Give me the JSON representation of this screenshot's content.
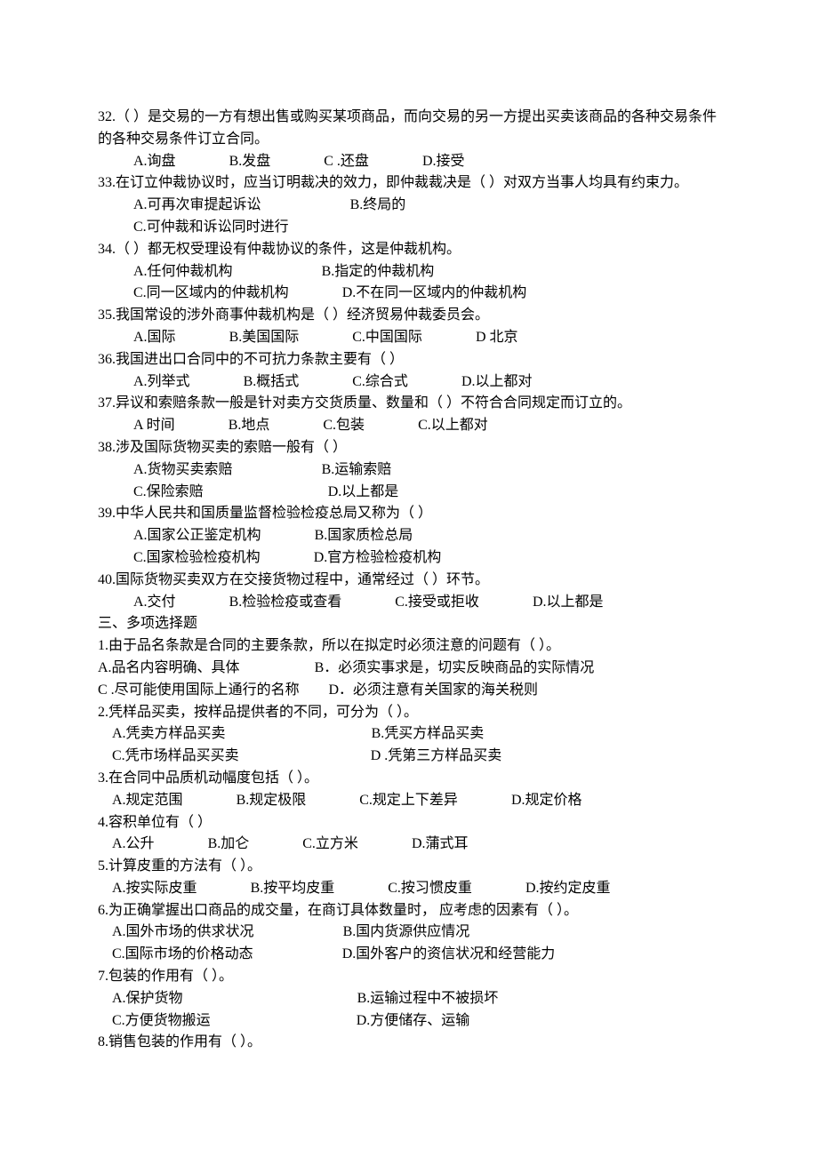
{
  "q32": {
    "text": "32.（   ）是交易的一方有想出售或购买某项商品，而向交易的另一方提出买卖该商品的各种交易条件的各种交易条件订立合同。",
    "a": "A.询盘",
    "b": "B.发盘",
    "c": "C .还盘",
    "d": "D.接受"
  },
  "q33": {
    "text": "33.在订立仲裁协议时，应当订明裁决的效力，即仲裁裁决是（   ）对双方当事人均具有约束力。",
    "a": "A.可再次审提起诉讼",
    "b": "B.终局的",
    "c": "C.可仲裁和诉讼同时进行"
  },
  "q34": {
    "text": "34.（  ）都无权受理设有仲裁协议的条件，这是仲裁机构。",
    "a": "A.任何仲裁机构",
    "b": "B.指定的仲裁机构",
    "c": "C.同一区域内的仲裁机构",
    "d": "D.不在同一区域内的仲裁机构"
  },
  "q35": {
    "text": "35.我国常设的涉外商事仲裁机构是（  ）经济贸易仲裁委员会。",
    "a": "A.国际",
    "b": "B.美国国际",
    "c": "C.中国国际",
    "d": "D 北京"
  },
  "q36": {
    "text": "36.我国进出口合同中的不可抗力条款主要有（   ）",
    "a": "A.列举式",
    "b": "B.概括式",
    "c": "C.综合式",
    "d": "D.以上都对"
  },
  "q37": {
    "text": "37.异议和索赔条款一般是针对卖方交货质量、数量和（    ）不符合合同规定而订立的。",
    "a": "A 时间",
    "b": "B.地点",
    "c": "C.包装",
    "d": "C.以上都对"
  },
  "q38": {
    "text": "38.涉及国际货物买卖的索赔一般有（    ）",
    "a": "A.货物买卖索赔",
    "b": "B.运输索赔",
    "c": "C.保险索赔",
    "d": "D.以上都是"
  },
  "q39": {
    "text": "39.中华人民共和国质量监督检验检疫总局又称为（   ）",
    "a": "A.国家公正鉴定机构",
    "b": "B.国家质检总局",
    "c": "C.国家检验检疫机构",
    "d": "D.官方检验检疫机构"
  },
  "q40": {
    "text": "40.国际货物买卖双方在交接货物过程中，通常经过（   ）环节。",
    "a": "A.交付",
    "b": "B.检验检疫或查看",
    "c": "C.接受或拒收",
    "d": "D.以上都是"
  },
  "section3": "三、多项选择题",
  "m1": {
    "text": "1.由于品名条款是合同的主要条款，所以在拟定时必须注意的问题有（      ）。",
    "a": "A.品名内容明确、具体",
    "b": "B．必须实事求是，切实反映商品的实际情况",
    "c": "C .尽可能使用国际上通行的名称",
    "d": "D．必须注意有关国家的海关税则"
  },
  "m2": {
    "text": "2.凭样品买卖，按样品提供者的不同，可分为（     ）。",
    "a": "A.凭卖方样品买卖",
    "b": "B.凭买方样品买卖",
    "c": "C.凭市场样品买买卖",
    "d": "D .凭第三方样品买卖"
  },
  "m3": {
    "text": "3.在合同中品质机动幅度包括（      ）。",
    "a": "A.规定范围",
    "b": "B.规定极限",
    "c": "C.规定上下差异",
    "d": "D.规定价格"
  },
  "m4": {
    "text": "4.容积单位有（       ）",
    "a": "A.公升",
    "b": "B.加仑",
    "c": "C.立方米",
    "d": "D.蒲式耳"
  },
  "m5": {
    "text": "5.计算皮重的方法有（      ）。",
    "a": "A.按实际皮重",
    "b": "B.按平均皮重",
    "c": "C.按习惯皮重",
    "d": "D.按约定皮重"
  },
  "m6": {
    "text": "6.为正确掌握出口商品的成交量，在商订具体数量时，  应考虑的因素有（       ）。",
    "a": "A.国外市场的供求状况",
    "b": "B.国内货源供应情况",
    "c": "C.国际市场的价格动态",
    "d": "D.国外客户的资信状况和经营能力"
  },
  "m7": {
    "text": "7.包装的作用有（     ）。",
    "a": "A.保护货物",
    "b": "B.运输过程中不被损坏",
    "c": "C.方便货物搬运",
    "d": "D.方便储存、运输"
  },
  "m8": {
    "text": "8.销售包装的作用有（      ）。"
  }
}
